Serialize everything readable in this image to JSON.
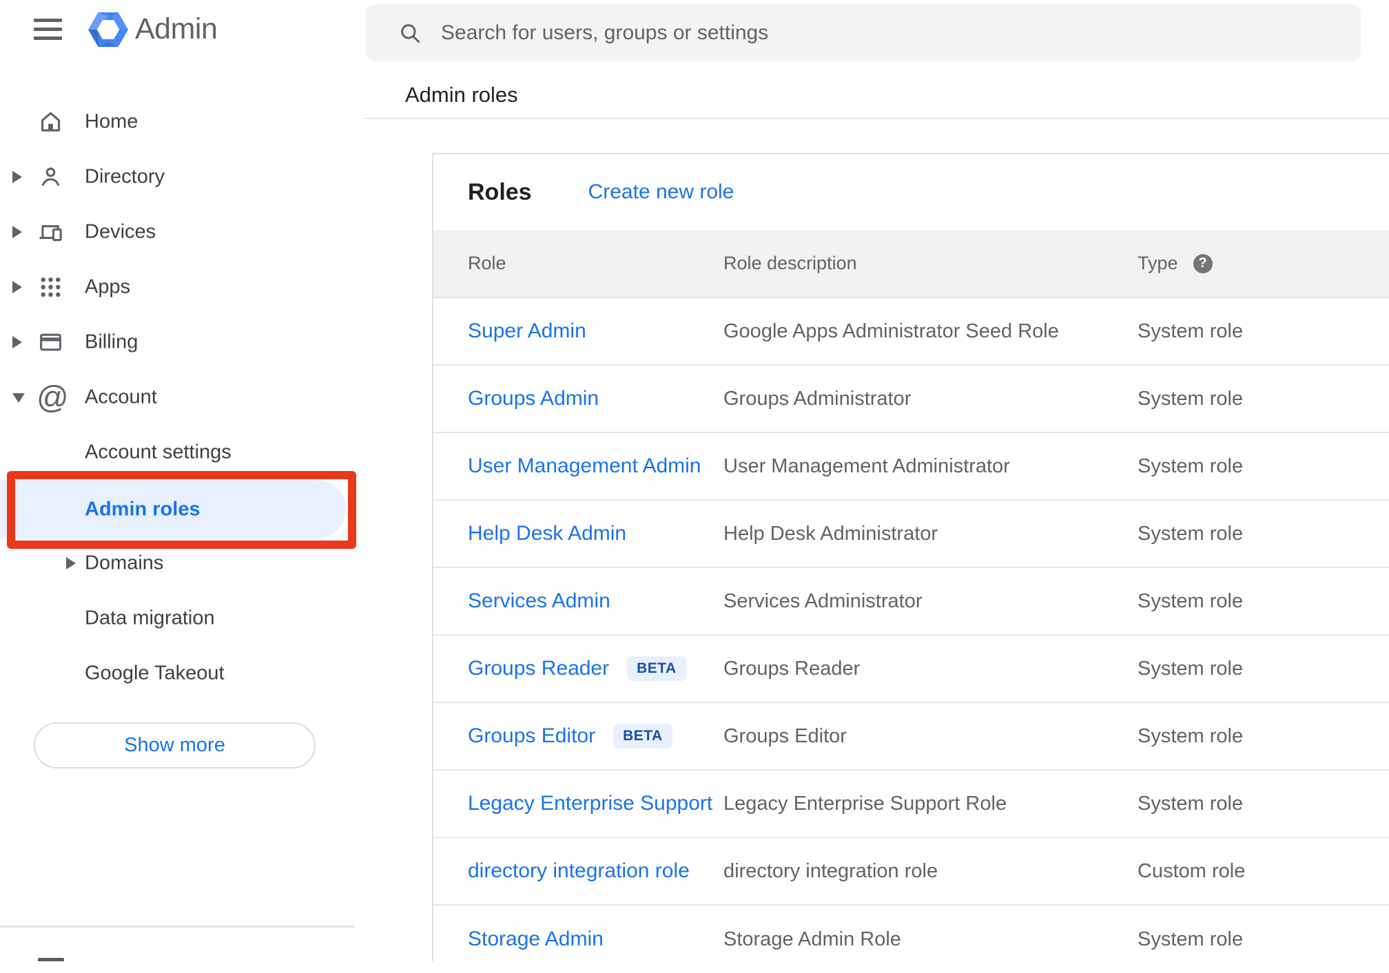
{
  "topbar": {
    "logo_text": "Admin",
    "search_placeholder": "Search for users, groups or settings"
  },
  "breadcrumb": "Admin roles",
  "sidebar": {
    "items": [
      {
        "label": "Home"
      },
      {
        "label": "Directory"
      },
      {
        "label": "Devices"
      },
      {
        "label": "Apps"
      },
      {
        "label": "Billing"
      },
      {
        "label": "Account"
      },
      {
        "label": "Account settings"
      },
      {
        "label": "Admin roles"
      },
      {
        "label": "Domains"
      },
      {
        "label": "Data migration"
      },
      {
        "label": "Google Takeout"
      }
    ],
    "show_more_label": "Show more"
  },
  "main": {
    "card_title": "Roles",
    "create_link": "Create new role",
    "table": {
      "headers": {
        "role": "Role",
        "description": "Role description",
        "type": "Type"
      },
      "rows": [
        {
          "role": "Super Admin",
          "description": "Google Apps Administrator Seed Role",
          "type": "System role"
        },
        {
          "role": "Groups Admin",
          "description": "Groups Administrator",
          "type": "System role"
        },
        {
          "role": "User Management Admin",
          "description": "User Management Administrator",
          "type": "System role"
        },
        {
          "role": "Help Desk Admin",
          "description": "Help Desk Administrator",
          "type": "System role"
        },
        {
          "role": "Services Admin",
          "description": "Services Administrator",
          "type": "System role"
        },
        {
          "role": "Groups Reader",
          "badge": "BETA",
          "description": "Groups Reader",
          "type": "System role"
        },
        {
          "role": "Groups Editor",
          "badge": "BETA",
          "description": "Groups Editor",
          "type": "System role"
        },
        {
          "role": "Legacy Enterprise Support",
          "description": "Legacy Enterprise Support Role",
          "type": "System role"
        },
        {
          "role": "directory integration role",
          "description": "directory integration role",
          "type": "Custom role"
        },
        {
          "role": "Storage Admin",
          "description": "Storage Admin Role",
          "type": "System role"
        }
      ]
    }
  },
  "colors": {
    "accent_blue": "#1a73e8",
    "annotation_red": "#e8391d",
    "badge_bg": "#e8f0fe",
    "badge_text": "#174ea6",
    "table_header_bg": "#f2f2f2",
    "logo_blue": "#4285f4"
  }
}
